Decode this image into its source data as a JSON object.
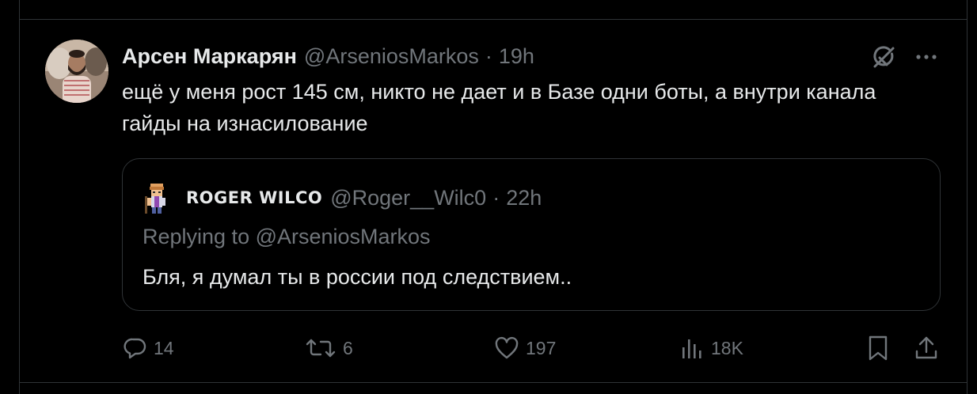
{
  "tweet": {
    "author_name": "Арсен Маркарян",
    "author_handle": "@ArseniosMarkos",
    "separator": "·",
    "time": "19h",
    "text": "ещё у меня рост 145 см, никто не дает и в Базе одни боты, а внутри канала гайды на изнасилование"
  },
  "quoted_tweet": {
    "author_name": "ROGER WILCO",
    "author_handle": "@Roger__Wilc0",
    "separator": "·",
    "time": "22h",
    "replying_to": "Replying to @ArseniosMarkos",
    "text": "Бля, я думал ты в россии под следствием.."
  },
  "actions": {
    "replies": "14",
    "reposts": "6",
    "likes": "197",
    "views": "18K"
  },
  "icons": {
    "grok": "grok-icon",
    "more": "more-icon",
    "reply": "reply-icon",
    "repost": "repost-icon",
    "like": "heart-icon",
    "views": "views-icon",
    "bookmark": "bookmark-icon",
    "share": "share-icon"
  },
  "colors": {
    "background": "#000000",
    "text_primary": "#e7e9ea",
    "text_secondary": "#71767b",
    "border": "#2f3336"
  }
}
